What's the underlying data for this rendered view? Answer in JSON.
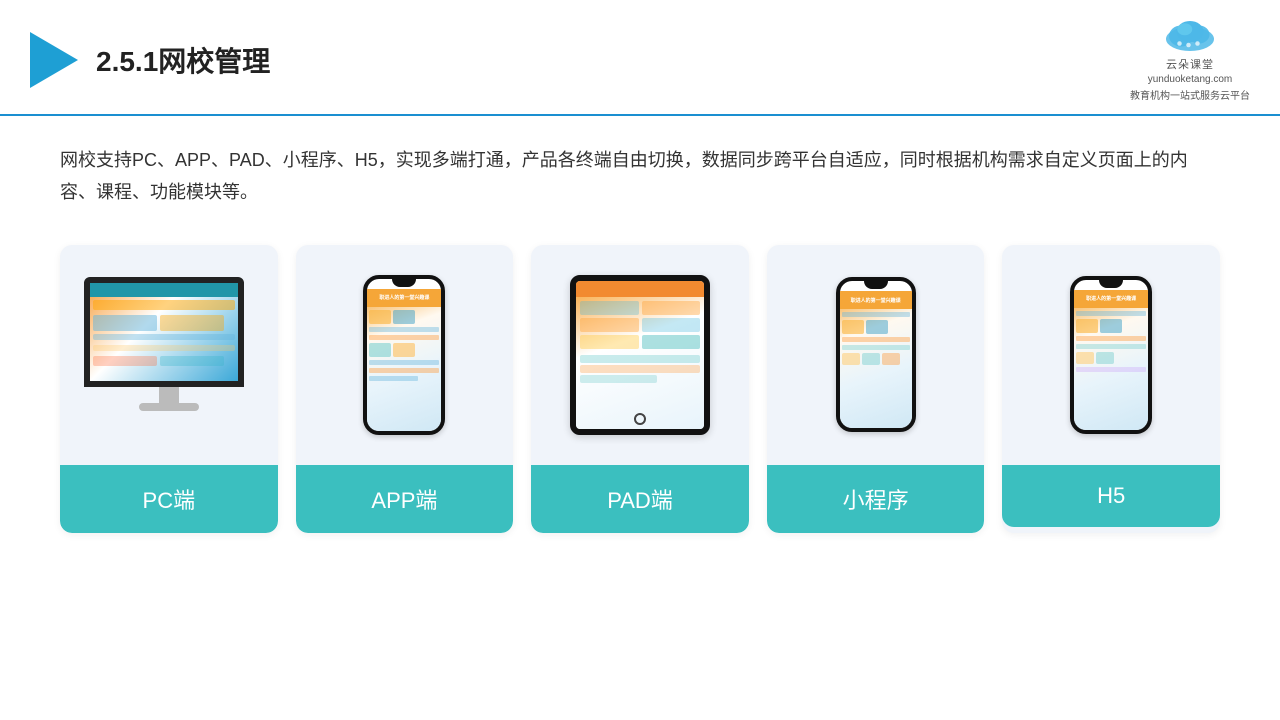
{
  "header": {
    "title": "2.5.1网校管理",
    "brand": {
      "name": "云朵课堂",
      "url": "yunduoketang.com",
      "subtitle": "教育机构一站式服务云平台"
    }
  },
  "description": "网校支持PC、APP、PAD、小程序、H5，实现多端打通，产品各终端自由切换，数据同步跨平台自适应，同时根据机构需求自定义页面上的内容、课程、功能模块等。",
  "cards": [
    {
      "id": "pc",
      "label": "PC端"
    },
    {
      "id": "app",
      "label": "APP端"
    },
    {
      "id": "pad",
      "label": "PAD端"
    },
    {
      "id": "miniapp",
      "label": "小程序"
    },
    {
      "id": "h5",
      "label": "H5"
    }
  ],
  "colors": {
    "accent": "#3bbfbf",
    "header_line": "#1a8fd1",
    "logo_triangle": "#1e9fd4",
    "text_dark": "#222222",
    "text_body": "#333333",
    "card_bg": "#f0f4fa"
  }
}
